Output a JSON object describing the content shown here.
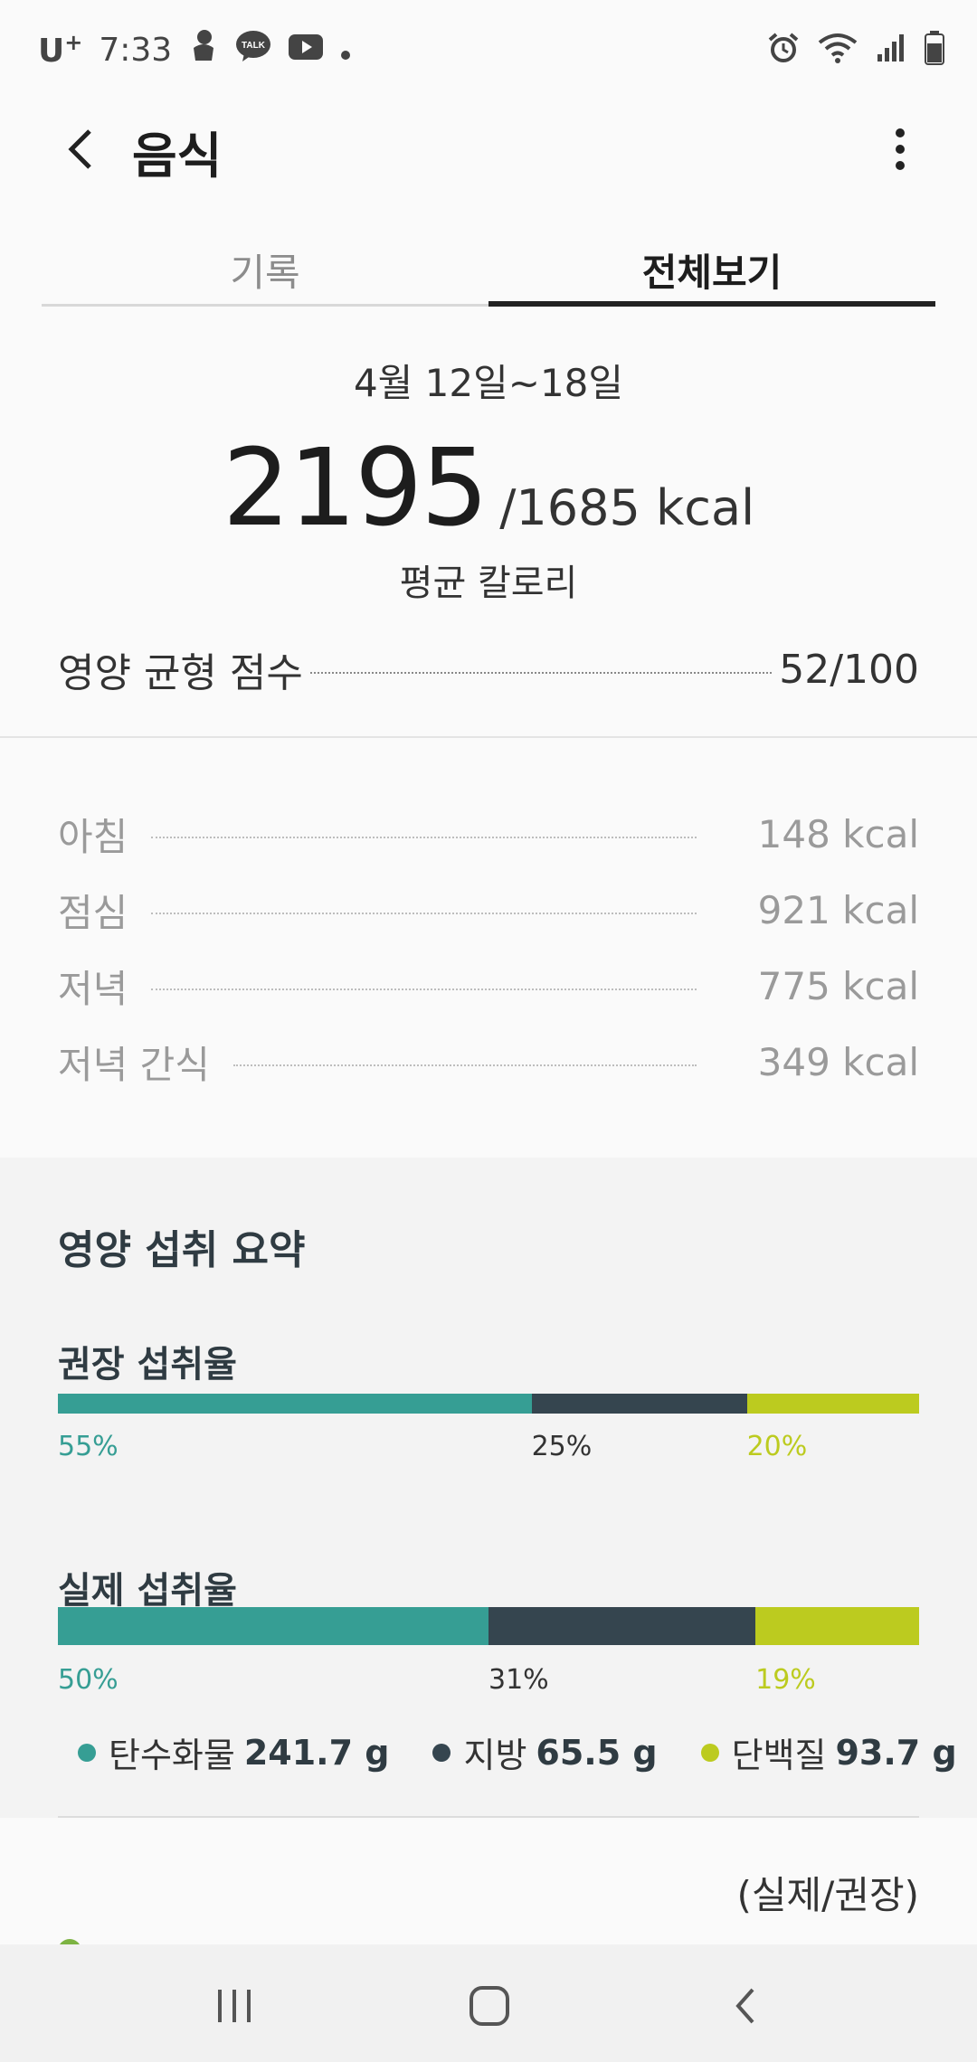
{
  "status_bar": {
    "carrier": "U",
    "carrier_sup": "+",
    "time": "7:33",
    "notification_icons": [
      "baby-icon",
      "kakaotalk-icon",
      "youtube-icon",
      "dot-icon"
    ],
    "kakao_text": "TALK",
    "right_icons": [
      "alarm-icon",
      "wifi-icon",
      "signal-icon",
      "battery-icon"
    ]
  },
  "header": {
    "title": "음식"
  },
  "tabs": [
    {
      "label": "기록",
      "selected": false
    },
    {
      "label": "전체보기",
      "selected": true
    }
  ],
  "summary": {
    "date_range": "4월 12일~18일",
    "average_calories": "2195",
    "target": "/1685 kcal",
    "average_label": "평균 칼로리",
    "score_label": "영양 균형 점수",
    "score_value": "52/100"
  },
  "meals": [
    {
      "label": "아침",
      "value": "148 kcal"
    },
    {
      "label": "점심",
      "value": "921 kcal"
    },
    {
      "label": "저녁",
      "value": "775 kcal"
    },
    {
      "label": "저녁 간식",
      "value": "349 kcal"
    }
  ],
  "nutrition": {
    "title": "영양 섭취 요약",
    "recommended": {
      "label": "권장 섭취율",
      "carbs": 55,
      "fat": 25,
      "protein": 20,
      "carbs_label": "55%",
      "fat_label": "25%",
      "protein_label": "20%"
    },
    "actual": {
      "label": "실제 섭취율",
      "carbs": 50,
      "fat": 31,
      "protein": 19,
      "carbs_label": "50%",
      "fat_label": "31%",
      "protein_label": "19%"
    },
    "legend": [
      {
        "name": "탄수화물",
        "amount": "241.7 g",
        "color": "#369e94"
      },
      {
        "name": "지방",
        "amount": "65.5 g",
        "color": "#35454f"
      },
      {
        "name": "단백질",
        "amount": "93.7 g",
        "color": "#bccb1f"
      }
    ],
    "ratio_label": "(실제/권장)"
  },
  "colors": {
    "carbs": "#369e94",
    "fat": "#35454f",
    "protein": "#bccb1f"
  },
  "nav_bar": {
    "buttons": [
      "recent-apps",
      "home",
      "back"
    ]
  }
}
